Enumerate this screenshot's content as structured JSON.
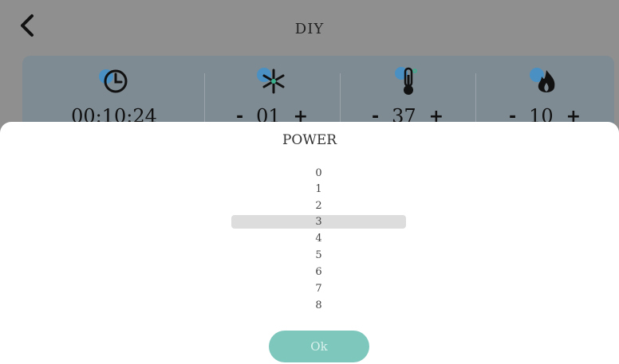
{
  "header": {
    "title": "DIY"
  },
  "panel": {
    "cells": [
      {
        "icon": "clock-icon",
        "value": "00:10:24"
      },
      {
        "icon": "fan-icon",
        "minus": "-",
        "value": "01",
        "plus": "+"
      },
      {
        "icon": "thermometer-icon",
        "minus": "-",
        "value": "37",
        "plus": "+"
      },
      {
        "icon": "flame-icon",
        "minus": "-",
        "value": "10",
        "plus": "+"
      }
    ]
  },
  "modal": {
    "title": "POWER",
    "options": [
      "0",
      "1",
      "2",
      "3",
      "4",
      "5",
      "6",
      "7",
      "8"
    ],
    "selected": "3",
    "ok_label": "Ok"
  },
  "colors": {
    "overlay": "#8f8f8f",
    "panel": "#7f8b93",
    "accent": "#7ec7bd",
    "icon_blue": "#4a90c2"
  }
}
